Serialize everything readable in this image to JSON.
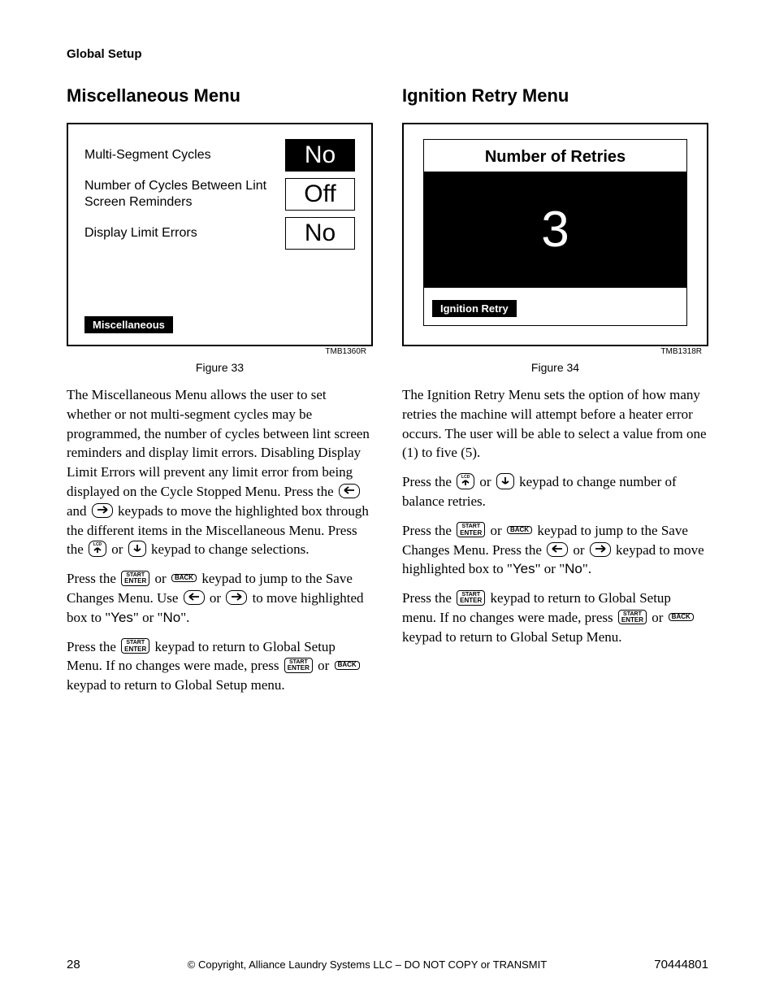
{
  "header": "Global Setup",
  "left": {
    "title": "Miscellaneous Menu",
    "fig": {
      "rows": [
        {
          "label": "Multi-Segment Cycles",
          "value": "No",
          "active": true
        },
        {
          "label": "Number of Cycles Between Lint Screen Reminders",
          "value": "Off",
          "active": false
        },
        {
          "label": "Display Limit Errors",
          "value": "No",
          "active": false
        }
      ],
      "tab": "Miscellaneous",
      "code": "TMB1360R",
      "caption": "Figure 33"
    },
    "p1a": "The Miscellaneous Menu allows the user to set whether or not multi-segment cycles may be programmed, the number of cycles between lint screen reminders and display limit errors. Disabling Display Limit Errors will prevent any limit error from being displayed on the Cycle Stopped Menu. Press the ",
    "p1b": " and ",
    "p1c": " keypads to move the highlighted box through the different items in the Miscellaneous Menu. Press the ",
    "p1d": " or ",
    "p1e": " keypad to change selections.",
    "p2a": "Press the ",
    "p2b": " or ",
    "p2c": " keypad to jump to the Save Changes Menu. Use ",
    "p2d": " or ",
    "p2e": " to move highlighted box to \"",
    "p2f": "\" or \"",
    "p2g": "\".",
    "p3a": "Press the ",
    "p3b": " keypad to return to Global Setup Menu. If no changes were made, press ",
    "p3c": " or ",
    "p3d": " keypad to return to Global Setup menu.",
    "yes": "Yes",
    "no": "No"
  },
  "right": {
    "title": "Ignition Retry Menu",
    "fig": {
      "title": "Number of Retries",
      "value": "3",
      "tab": "Ignition Retry",
      "code": "TMB1318R",
      "caption": "Figure 34"
    },
    "p1": "The Ignition Retry Menu sets the option of how many retries the machine will attempt before a heater error occurs. The user will be able to select a value from one (1) to five (5).",
    "p2a": "Press the ",
    "p2b": " or ",
    "p2c": " keypad to change number of balance retries.",
    "p3a": "Press the ",
    "p3b": " or ",
    "p3c": " keypad to jump to the Save Changes Menu. Press the ",
    "p3d": " or ",
    "p3e": " keypad to move highlighted box to \"",
    "p3f": "\" or \"",
    "p3g": "\".",
    "p4a": "Press the ",
    "p4b": " keypad to return to Global Setup menu. If no changes were made, press ",
    "p4c": " or ",
    "p4d": " keypad to return to Global Setup Menu.",
    "yes": "Yes",
    "no": "No"
  },
  "keys": {
    "start_enter_l1": "START",
    "start_enter_l2": "ENTER",
    "back": "BACK",
    "lcd": "LCD"
  },
  "footer": {
    "page": "28",
    "copyright": "© Copyright, Alliance Laundry Systems LLC – DO NOT COPY or TRANSMIT",
    "docnum": "70444801"
  }
}
